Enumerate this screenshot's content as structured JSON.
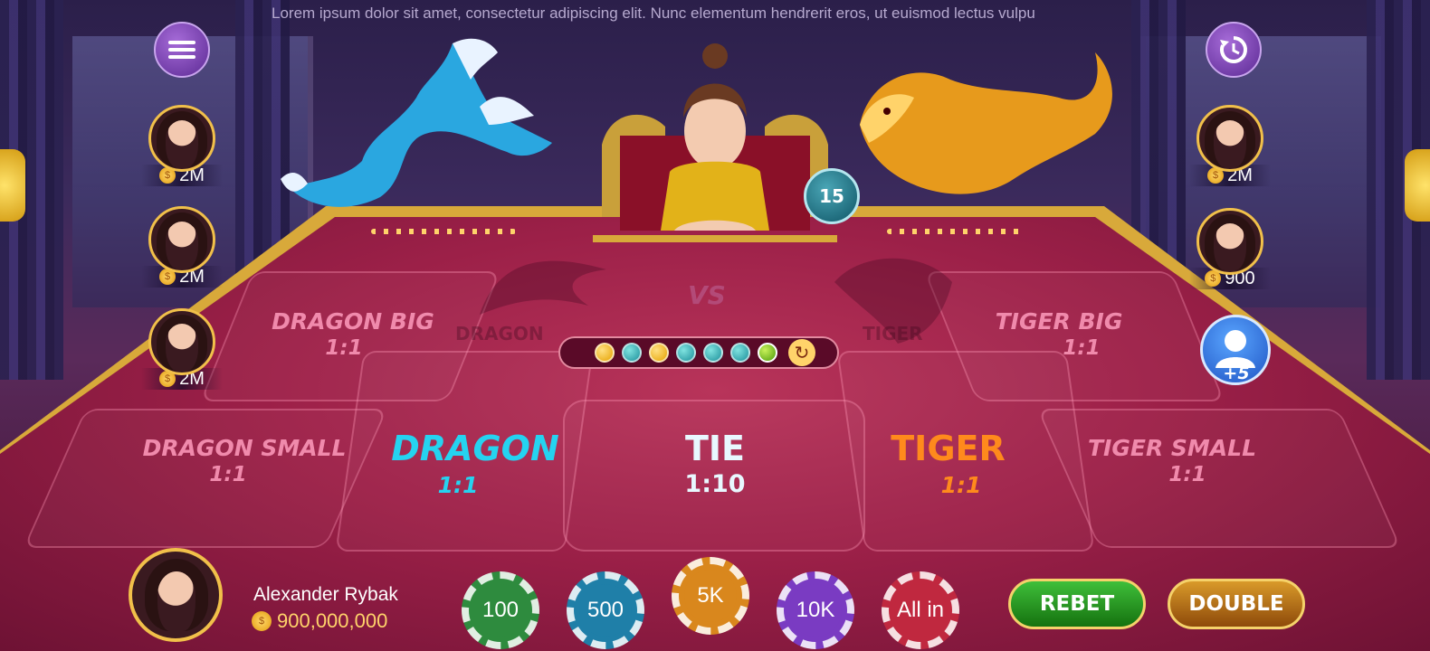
{
  "marquee": "Lorem ipsum dolor sit amet, consectetur adipiscing elit. Nunc elementum hendrerit eros, ut euismod lectus vulpu",
  "table": {
    "vs": "VS",
    "dragon_emblem": "DRAGON",
    "tiger_emblem": "TIGER",
    "bets": {
      "dragon_big": {
        "label": "DRAGON BIG",
        "odds": "1:1"
      },
      "dragon_small": {
        "label": "DRAGON SMALL",
        "odds": "1:1"
      },
      "dragon": {
        "label": "DRAGON",
        "odds": "1:1",
        "color": "#25d3f0"
      },
      "tie": {
        "label": "TIE",
        "odds": "1:10",
        "color": "#e8f8ff"
      },
      "tiger": {
        "label": "TIGER",
        "odds": "1:1",
        "color": "#ff8a1c"
      },
      "tiger_big": {
        "label": "TIGER BIG",
        "odds": "1:1"
      },
      "tiger_small": {
        "label": "TIGER SMALL",
        "odds": "1:1"
      }
    },
    "road": [
      "gold",
      "teal",
      "gold",
      "teal",
      "teal",
      "teal",
      "green"
    ]
  },
  "timer": "15",
  "left_players": [
    {
      "balance": "2M"
    },
    {
      "balance": "2M"
    },
    {
      "balance": "2M"
    }
  ],
  "right_players": [
    {
      "balance": "2M"
    },
    {
      "balance": "900"
    }
  ],
  "more_players": "+5",
  "self": {
    "name": "Alexander Rybak",
    "balance": "900,000,000"
  },
  "chips": [
    {
      "label": "100",
      "color": "#2e8b3e"
    },
    {
      "label": "500",
      "color": "#1f7fa8"
    },
    {
      "label": "5K",
      "color": "#d9871d"
    },
    {
      "label": "10K",
      "color": "#7a3bc2"
    },
    {
      "label": "All in",
      "color": "#c0283f"
    }
  ],
  "actions": {
    "rebet": "REBET",
    "double": "DOUBLE"
  },
  "icons": {
    "menu": "menu-icon",
    "history": "history-icon"
  }
}
